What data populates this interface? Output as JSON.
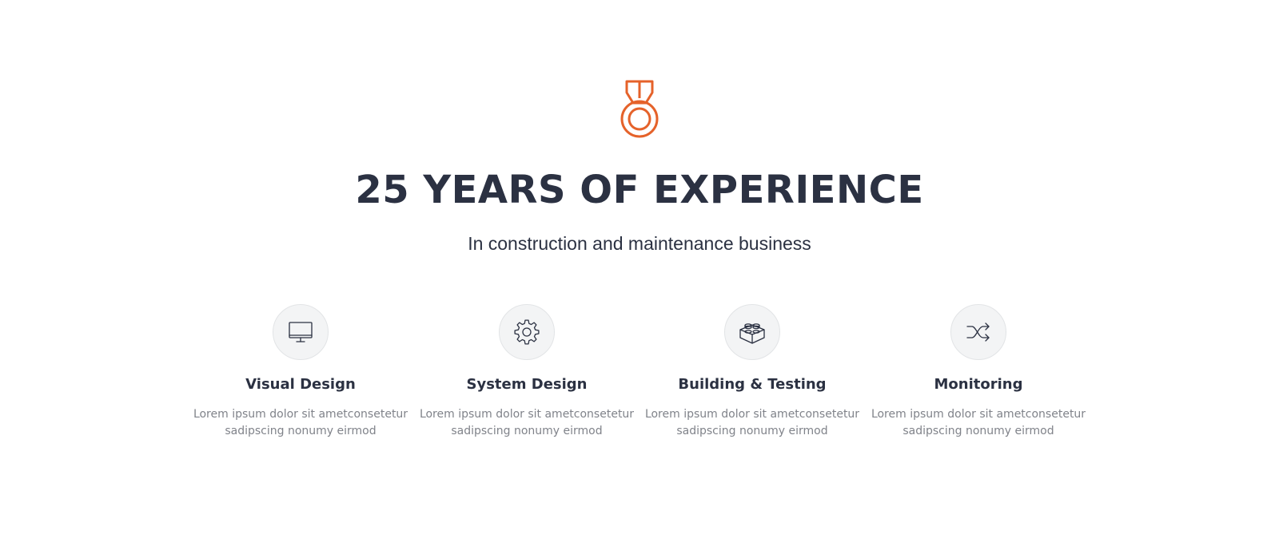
{
  "colors": {
    "accent": "#e5622a",
    "heading": "#2b3142",
    "body_text": "#80838a",
    "icon_circle_bg": "#f3f4f5"
  },
  "hero": {
    "icon": "medal-icon",
    "title": "25 YEARS OF EXPERIENCE",
    "subtitle": "In construction and maintenance business"
  },
  "features": [
    {
      "icon": "monitor-icon",
      "title": "Visual Design",
      "text_line1": "Lorem ipsum dolor sit ametconsetetur",
      "text_line2": "sadipscing nonumy eirmod"
    },
    {
      "icon": "gear-icon",
      "title": "System Design",
      "text_line1": "Lorem ipsum dolor sit ametconsetetur",
      "text_line2": "sadipscing nonumy eirmod"
    },
    {
      "icon": "lego-brick-icon",
      "title": "Building & Testing",
      "text_line1": "Lorem ipsum dolor sit ametconsetetur",
      "text_line2": "sadipscing nonumy eirmod"
    },
    {
      "icon": "shuffle-icon",
      "title": "Monitoring",
      "text_line1": "Lorem ipsum dolor sit ametconsetetur",
      "text_line2": "sadipscing nonumy eirmod"
    }
  ]
}
